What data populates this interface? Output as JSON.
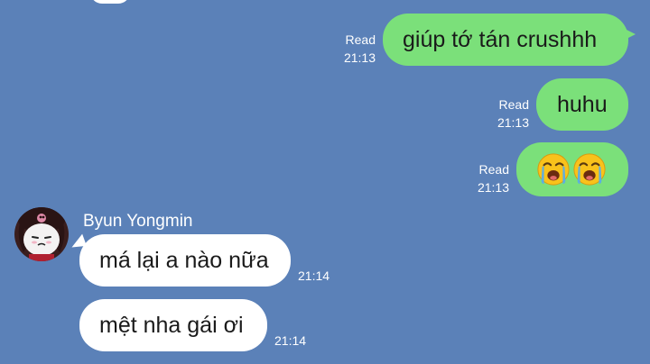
{
  "messages": [
    {
      "direction": "out",
      "text": "giúp tớ tán crushhh",
      "status": "Read",
      "time": "21:13"
    },
    {
      "direction": "out",
      "text": "huhu",
      "status": "Read",
      "time": "21:13"
    },
    {
      "direction": "out",
      "emoji": [
        "loudly-crying-face",
        "loudly-crying-face"
      ],
      "status": "Read",
      "time": "21:13"
    },
    {
      "direction": "in",
      "sender": "Byun Yongmin",
      "text": "má lại a nào nữa",
      "time": "21:14"
    },
    {
      "direction": "in",
      "text": "mệt nha gái ơi",
      "time": "21:14"
    }
  ],
  "colors": {
    "background": "#5B81B8",
    "outgoing_bubble": "#7BE07A",
    "incoming_bubble": "#FFFFFF",
    "meta_text": "#FFFFFF"
  }
}
